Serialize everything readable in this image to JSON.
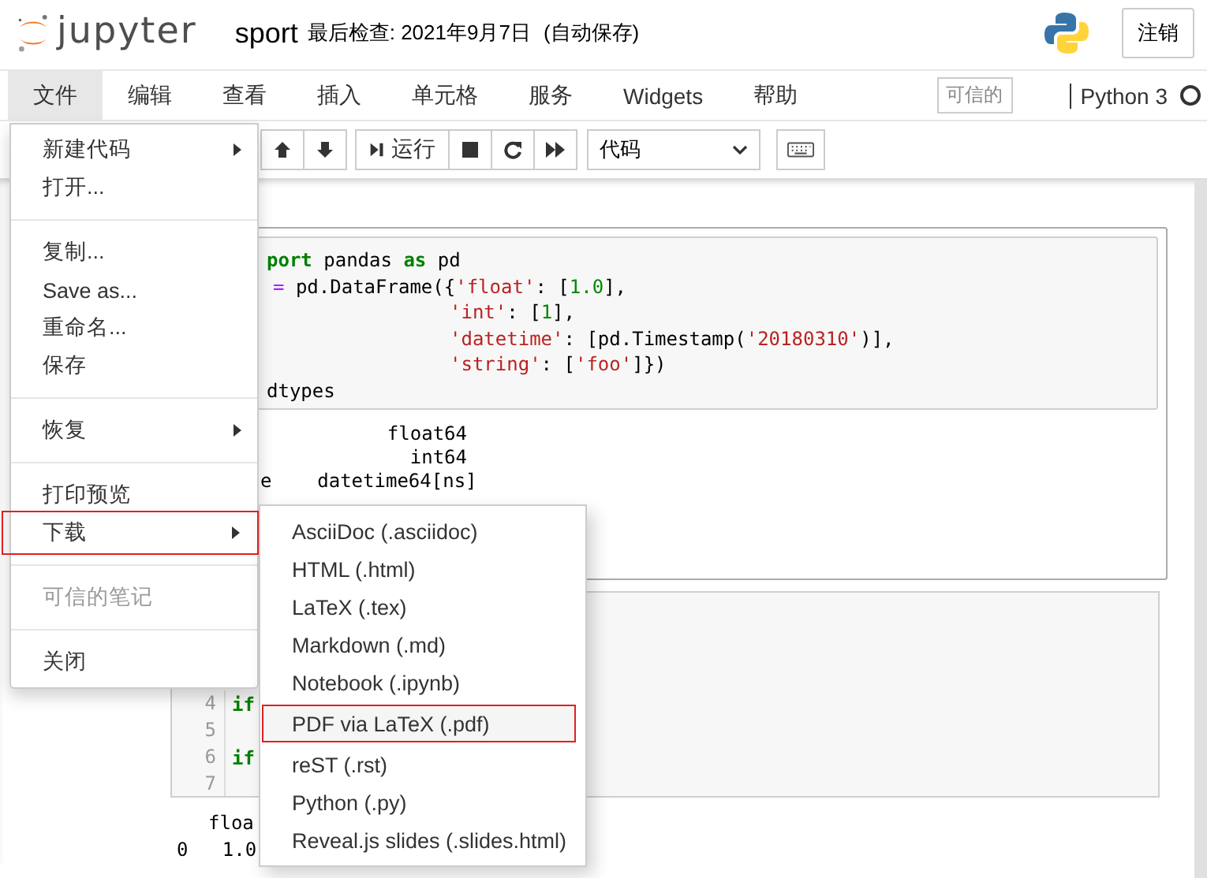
{
  "header": {
    "logo_text": "jupyter",
    "notebook_name": "sport",
    "checkpoint": "最后检查: 2021年9月7日",
    "autosave": "(自动保存)",
    "logout": "注销"
  },
  "menubar": {
    "items": [
      {
        "label": "文件",
        "selected": true
      },
      {
        "label": "编辑",
        "selected": false
      },
      {
        "label": "查看",
        "selected": false
      },
      {
        "label": "插入",
        "selected": false
      },
      {
        "label": "单元格",
        "selected": false
      },
      {
        "label": "服务",
        "selected": false
      },
      {
        "label": "Widgets",
        "selected": false
      },
      {
        "label": "帮助",
        "selected": false
      }
    ],
    "trusted": "可信的",
    "kernel": "Python 3"
  },
  "toolbar": {
    "run": "运行",
    "cell_type": "代码"
  },
  "cells": [
    {
      "kind": "source",
      "lines": [
        {
          "kind": "statement",
          "tokens": [
            {
              "t": "port",
              "kind": "kw"
            },
            {
              "t": " pandas ",
              "kind": "plain"
            },
            {
              "t": "as",
              "kind": "kw"
            },
            {
              "t": " pd",
              "kind": "plain"
            }
          ]
        },
        {
          "kind": "statement",
          "tokens": [
            {
              "t": "=",
              "kind": "op"
            },
            {
              "t": " pd.DataFrame({",
              "kind": "plain"
            },
            {
              "t": "'float'",
              "kind": "str"
            },
            {
              "t": ": [",
              "kind": "plain"
            },
            {
              "t": "1.0",
              "kind": "num"
            },
            {
              "t": "],",
              "kind": "plain"
            }
          ]
        },
        {
          "kind": "continuation",
          "tokens": [
            {
              "t": "'int'",
              "kind": "str"
            },
            {
              "t": ": [",
              "kind": "plain"
            },
            {
              "t": "1",
              "kind": "num"
            },
            {
              "t": "],",
              "kind": "plain"
            }
          ]
        },
        {
          "kind": "continuation",
          "tokens": [
            {
              "t": "'datetime'",
              "kind": "str"
            },
            {
              "t": ": [pd.Timestamp(",
              "kind": "plain"
            },
            {
              "t": "'20180310'",
              "kind": "str"
            },
            {
              "t": ")],",
              "kind": "plain"
            }
          ]
        },
        {
          "kind": "continuation",
          "tokens": [
            {
              "t": "'string'",
              "kind": "str"
            },
            {
              "t": ": [",
              "kind": "plain"
            },
            {
              "t": "'foo'",
              "kind": "str"
            },
            {
              "t": "]})",
              "kind": "plain"
            }
          ]
        },
        {
          "kind": "tail",
          "tokens": [
            {
              "t": "dtypes",
              "kind": "plain"
            }
          ]
        }
      ],
      "output": [
        "float64",
        "int64",
        "e    datetime64[ns]"
      ]
    },
    {
      "kind": "numbered",
      "lines": [
        {
          "number": "4",
          "tokens": [
            {
              "t": "if",
              "kind": "kw"
            }
          ]
        },
        {
          "number": "5"
        },
        {
          "number": "6",
          "tokens": [
            {
              "t": "if",
              "kind": "kw"
            }
          ]
        },
        {
          "number": "7"
        }
      ],
      "output": [
        "floa",
        "0   1.0"
      ]
    }
  ],
  "file_menu": {
    "items": [
      {
        "kind": "item",
        "label": "新建代码",
        "submenu": true,
        "disabled": false,
        "selected": false
      },
      {
        "kind": "item",
        "label": "打开...",
        "submenu": false,
        "disabled": false,
        "selected": false
      },
      {
        "kind": "divider"
      },
      {
        "kind": "item",
        "label": "复制...",
        "submenu": false,
        "disabled": false,
        "selected": false
      },
      {
        "kind": "item",
        "label": "Save as...",
        "submenu": false,
        "disabled": false,
        "selected": false
      },
      {
        "kind": "item",
        "label": "重命名...",
        "submenu": false,
        "disabled": false,
        "selected": false
      },
      {
        "kind": "item",
        "label": "保存",
        "submenu": false,
        "disabled": false,
        "selected": false
      },
      {
        "kind": "divider"
      },
      {
        "kind": "item",
        "label": "恢复",
        "submenu": true,
        "disabled": false,
        "selected": false
      },
      {
        "kind": "divider"
      },
      {
        "kind": "item",
        "label": "打印预览",
        "submenu": false,
        "disabled": false,
        "selected": false
      },
      {
        "kind": "item",
        "label": "下载",
        "submenu": true,
        "disabled": false,
        "selected": true
      },
      {
        "kind": "divider"
      },
      {
        "kind": "item",
        "label": "可信的笔记",
        "submenu": false,
        "disabled": true,
        "selected": false
      },
      {
        "kind": "divider"
      },
      {
        "kind": "item",
        "label": "关闭",
        "submenu": false,
        "disabled": false,
        "selected": false
      }
    ]
  },
  "download_menu": {
    "items": [
      {
        "label": "AsciiDoc (.asciidoc)",
        "selected": false
      },
      {
        "label": "HTML (.html)",
        "selected": false
      },
      {
        "label": "LaTeX (.tex)",
        "selected": false
      },
      {
        "label": "Markdown (.md)",
        "selected": false
      },
      {
        "label": "Notebook (.ipynb)",
        "selected": false
      },
      {
        "label": "PDF via LaTeX (.pdf)",
        "selected": true
      },
      {
        "label": "reST (.rst)",
        "selected": false
      },
      {
        "label": "Python (.py)",
        "selected": false
      },
      {
        "label": "Reveal.js slides (.slides.html)",
        "selected": false
      }
    ]
  }
}
